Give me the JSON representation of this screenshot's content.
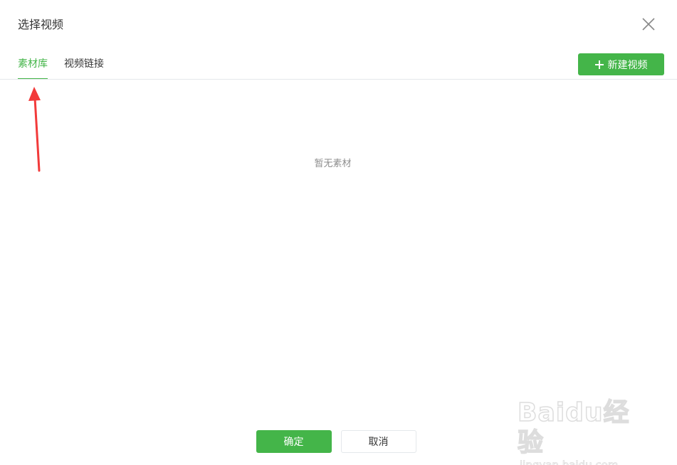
{
  "dialog": {
    "title": "选择视频"
  },
  "tabs": [
    {
      "label": "素材库",
      "active": true
    },
    {
      "label": "视频链接",
      "active": false
    }
  ],
  "toolbar": {
    "new_video_label": "新建视频"
  },
  "content": {
    "empty_text": "暂无素材"
  },
  "footer": {
    "confirm_label": "确定",
    "cancel_label": "取消"
  },
  "watermark": {
    "logo": "Baidu经验",
    "url": "jingyan.baidu.com"
  },
  "colors": {
    "accent": "#44b549",
    "annotation_arrow": "#f23a3a"
  }
}
